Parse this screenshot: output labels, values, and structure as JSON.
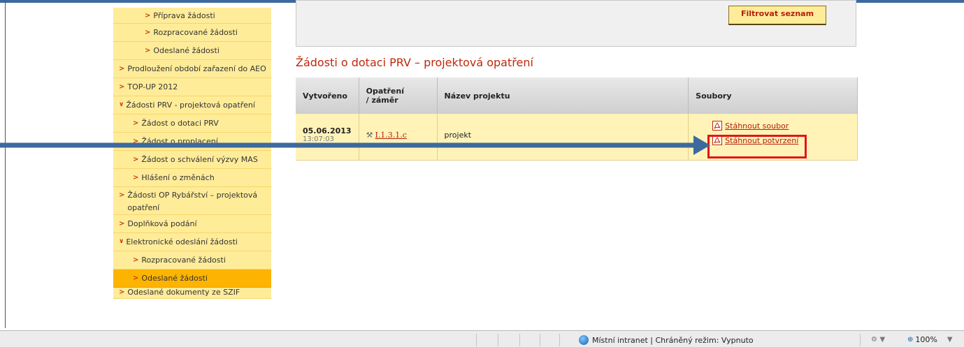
{
  "sidebar": {
    "items": [
      {
        "label": "Příprava žádosti"
      },
      {
        "label": "Rozpracované žádosti"
      },
      {
        "label": "Odeslané žádosti"
      },
      {
        "label": "Prodloužení období zařazení do AEO"
      },
      {
        "label": "TOP-UP 2012"
      },
      {
        "label": "Žádosti PRV - projektová opatření"
      },
      {
        "label": "Žádost o dotaci PRV"
      },
      {
        "label": "Žádost o proplacení"
      },
      {
        "label": "Žádost o schválení výzvy MAS"
      },
      {
        "label": "Hlášení o změnách"
      },
      {
        "label": "Žádosti OP Rybářství – projektová opatření"
      },
      {
        "label": "Doplňková podání"
      },
      {
        "label": "Elektronické odeslání žádosti"
      },
      {
        "label": "Rozpracované žádosti"
      },
      {
        "label": "Odeslané žádosti"
      },
      {
        "label": "Odeslané dokumenty ze SZIF"
      }
    ]
  },
  "filter": {
    "button_label": "Filtrovat seznam"
  },
  "page_title": "Žádosti o dotaci PRV – projektová opatření",
  "table": {
    "headers": {
      "created": "Vytvořeno",
      "measure": "Opatření / záměr",
      "project": "Název projektu",
      "files": "Soubory"
    },
    "rows": [
      {
        "date": "05.06.2013",
        "time": "13:07:03",
        "measure": "I.1.3.1.c",
        "project": "projekt",
        "download_file": "Stáhnout soubor",
        "download_confirmation": "Stáhnout potvrzení"
      }
    ]
  },
  "statusbar": {
    "zone_text": "Místní intranet | Chráněný režim: Vypnuto",
    "zoom": "100%"
  },
  "colors": {
    "accent": "#c0280c",
    "sidebar": "#ffec99",
    "sidebar_active": "#fdb400",
    "highlight": "#e3141a",
    "arrow": "#3d6a9e"
  }
}
